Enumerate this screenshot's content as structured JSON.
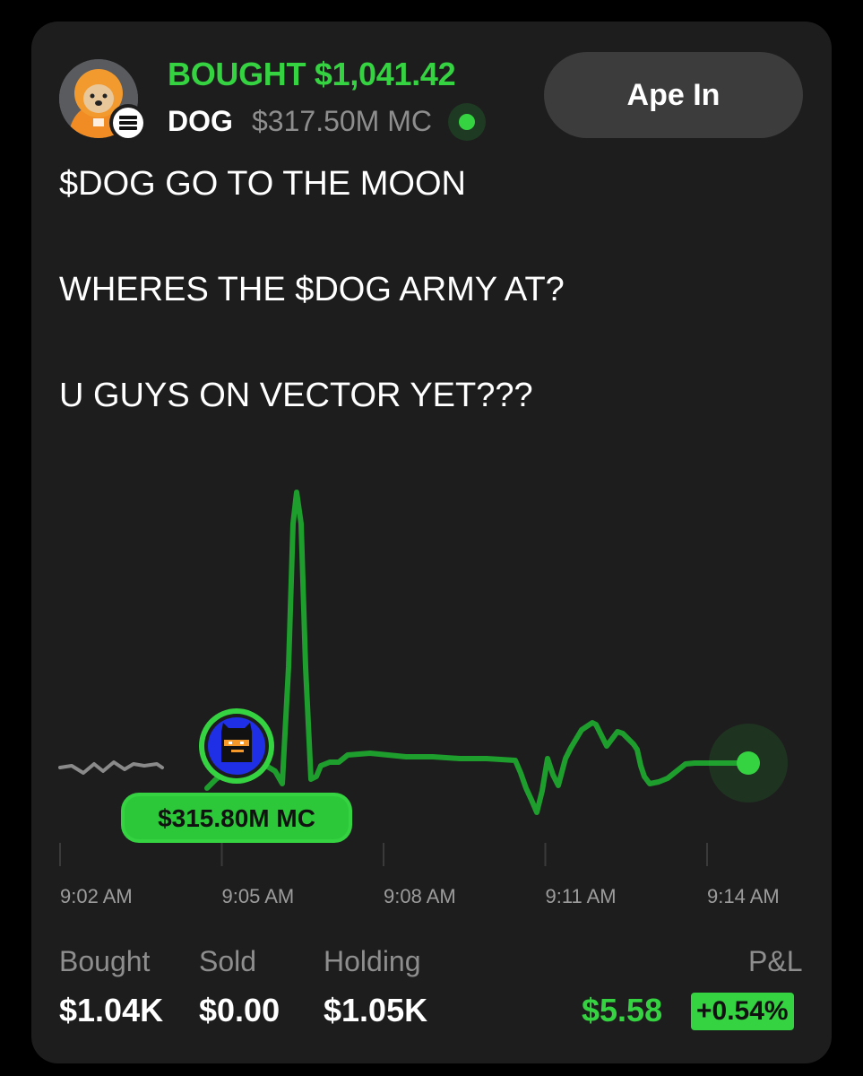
{
  "post": {
    "action": "BOUGHT $1,041.42",
    "ticker": "DOG",
    "market_cap": "$317.50M MC",
    "button_label": "Ape In",
    "lines": [
      "$DOG GO TO THE MOON",
      "WHERES THE $DOG ARMY AT?",
      "U GUYS ON VECTOR YET???"
    ]
  },
  "chart_data": {
    "type": "line",
    "x_ticks": [
      "9:02 AM",
      "9:05 AM",
      "9:08 AM",
      "9:11 AM",
      "9:14 AM"
    ],
    "buy_marker_label": "$315.80M MC",
    "colors": {
      "line": "#1e9e2d",
      "accent": "#35d341",
      "pre_buy_line": "#8a8a8a"
    }
  },
  "stats": {
    "bought_label": "Bought",
    "bought_value": "$1.04K",
    "sold_label": "Sold",
    "sold_value": "$0.00",
    "holding_label": "Holding",
    "holding_value": "$1.05K",
    "pnl_label": "P&L",
    "pnl_value": "$5.58",
    "pnl_percent": "+0.54%"
  }
}
